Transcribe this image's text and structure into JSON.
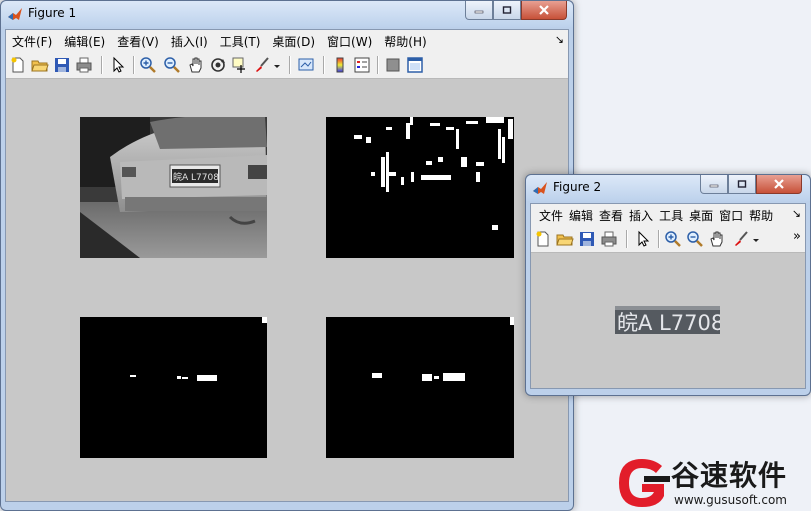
{
  "figure1": {
    "title": "Figure 1",
    "menu": [
      "文件(F)",
      "编辑(E)",
      "查看(V)",
      "插入(I)",
      "工具(T)",
      "桌面(D)",
      "窗口(W)",
      "帮助(H)"
    ],
    "pin_glyph": "↘",
    "axes": [
      {
        "name": "grayscale-car-image",
        "plate_text": "皖A L7708"
      },
      {
        "name": "edge-detected-image"
      },
      {
        "name": "morphology-image-1"
      },
      {
        "name": "morphology-image-2"
      }
    ]
  },
  "figure2": {
    "title": "Figure 2",
    "menu": [
      "文件",
      "编辑",
      "查看",
      "插入",
      "工具",
      "桌面",
      "窗口",
      "帮助"
    ],
    "pin_glyph": "↘",
    "overflow_glyph": "»",
    "plate_text": "皖A L7708"
  },
  "watermark": {
    "brand": "谷速软件",
    "url": "www.gususoft.com",
    "colors": {
      "red": "#e21d2a",
      "dark": "#1a1a1a"
    }
  }
}
